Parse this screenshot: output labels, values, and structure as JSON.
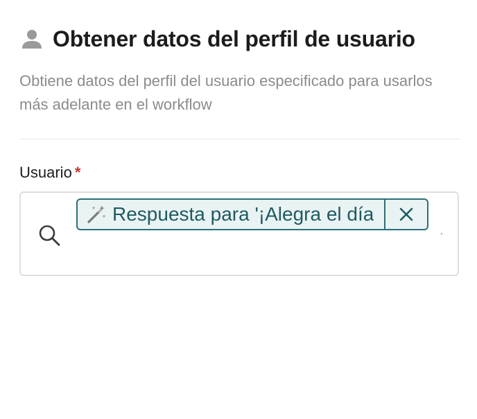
{
  "header": {
    "icon": "person-icon",
    "title": "Obtener datos del perfil de usuario",
    "description": "Obtiene datos del perfil del usuario especificado para usarlos más adelante en el workflow"
  },
  "user_field": {
    "label": "Usuario",
    "required_marker": "*",
    "search_icon": "search-icon",
    "token": {
      "icon": "magic-wand-icon",
      "text": "Respuesta para '¡Alegra el día",
      "remove_icon": "close-icon"
    }
  },
  "colors": {
    "title": "#1d1c1d",
    "description": "#8b8b8b",
    "required": "#c0392b",
    "token_border": "#2b6f77",
    "token_background": "#e9f3f3",
    "token_text": "#1f5a62",
    "field_border": "#dedede"
  }
}
